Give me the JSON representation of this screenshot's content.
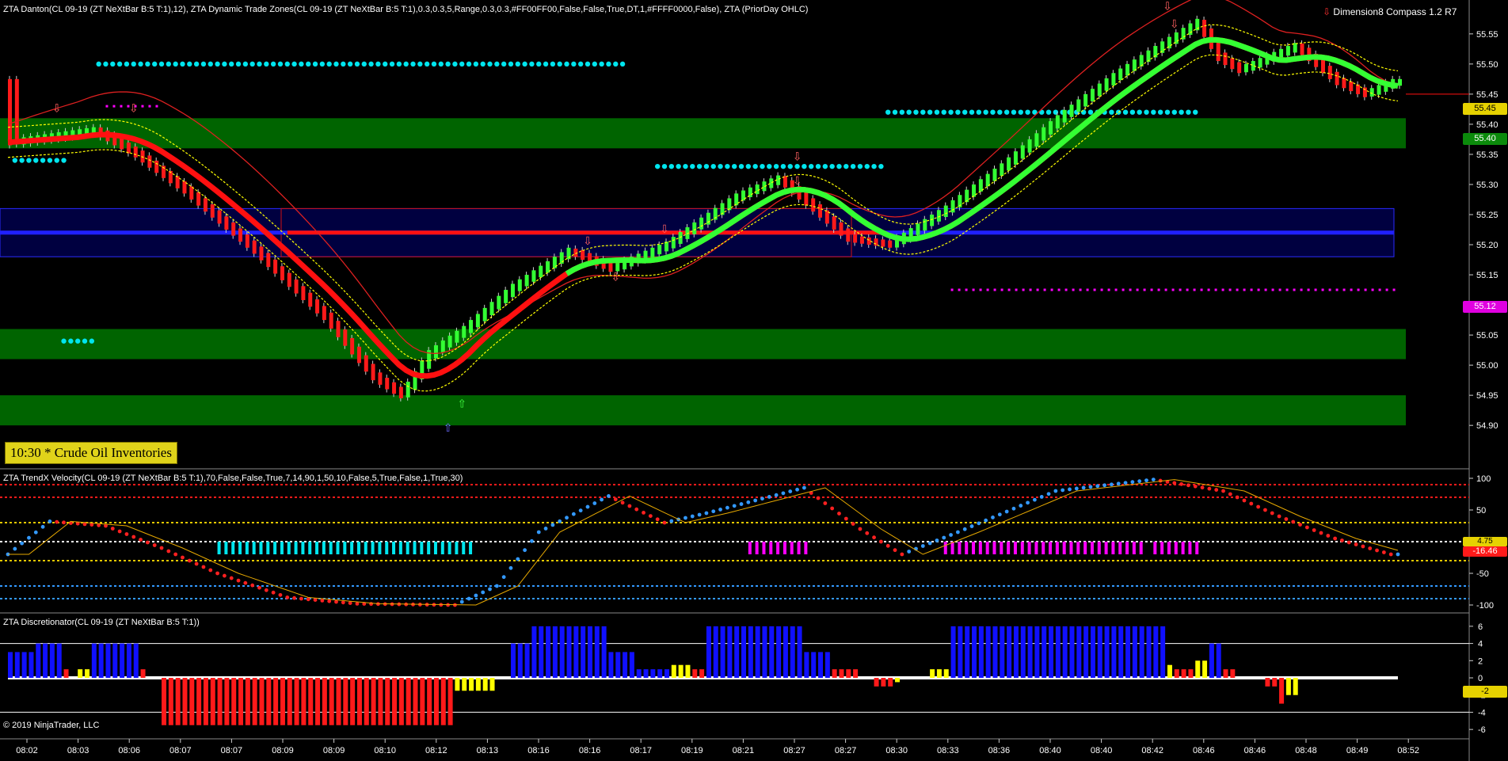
{
  "titles": {
    "price_panel": "ZTA Danton(CL 09-19 (ZT NeXtBar B:5 T:1),12), ZTA Dynamic Trade Zones(CL 09-19 (ZT NeXtBar B:5 T:1),0.3,0.3,5,Range,0.3,0.3,#FF00FF00,False,False,True,DT,1,#FFFF0000,False), ZTA (PriorDay OHLC)",
    "velocity_panel": "ZTA TrendX Velocity(CL 09-19 (ZT NeXtBar B:5 T:1),70,False,False,True,7,14,90,1,50,10,False,5,True,False,1,True,30)",
    "disc_panel": "ZTA Discretionator(CL 09-19 (ZT NeXtBar B:5 T:1))",
    "compass": "Dimension8 Compass 1.2 R7",
    "news": "10:30 * Crude Oil Inventories",
    "copyright": "© 2019 NinjaTrader, LLC"
  },
  "badges": {
    "last": "55.45",
    "zone": "55.40",
    "magenta": "55.12",
    "vel_a": "4.75",
    "vel_b": "-16.46",
    "disc": "-2"
  },
  "colors": {
    "bull": "#33ff33",
    "bear": "#ff1a1a",
    "zone": "#006400",
    "cyan": "#00e5ee",
    "magenta": "#ff00ff",
    "blue": "#1010ff",
    "yellow": "#ffff00"
  },
  "chart_data": [
    {
      "type": "bar",
      "name": "price",
      "x_ticks": [
        "08:02",
        "08:03",
        "08:06",
        "08:07",
        "08:07",
        "08:09",
        "08:09",
        "08:10",
        "08:12",
        "08:13",
        "08:16",
        "08:16",
        "08:17",
        "08:19",
        "08:21",
        "08:27",
        "08:27",
        "08:30",
        "08:33",
        "08:36",
        "08:40",
        "08:40",
        "08:42",
        "08:46",
        "08:46",
        "08:48",
        "08:49",
        "08:52"
      ],
      "y_ticks": [
        54.9,
        54.95,
        55.0,
        55.05,
        55.1,
        55.15,
        55.2,
        55.25,
        55.3,
        55.35,
        55.4,
        55.45,
        55.5,
        55.55
      ],
      "ylim": [
        54.87,
        55.58
      ],
      "anchors": [
        [
          0,
          55.37
        ],
        [
          12,
          55.39
        ],
        [
          18,
          55.35
        ],
        [
          25,
          55.29
        ],
        [
          35,
          55.19
        ],
        [
          45,
          55.08
        ],
        [
          52,
          54.98
        ],
        [
          56,
          54.95
        ],
        [
          60,
          55.02
        ],
        [
          65,
          55.06
        ],
        [
          72,
          55.13
        ],
        [
          80,
          55.19
        ],
        [
          86,
          55.16
        ],
        [
          94,
          55.2
        ],
        [
          104,
          55.28
        ],
        [
          110,
          55.31
        ],
        [
          116,
          55.25
        ],
        [
          120,
          55.21
        ],
        [
          126,
          55.2
        ],
        [
          134,
          55.26
        ],
        [
          142,
          55.33
        ],
        [
          150,
          55.41
        ],
        [
          158,
          55.48
        ],
        [
          166,
          55.54
        ],
        [
          170,
          55.57
        ],
        [
          173,
          55.51
        ],
        [
          176,
          55.49
        ],
        [
          184,
          55.53
        ],
        [
          190,
          55.47
        ],
        [
          194,
          55.45
        ],
        [
          198,
          55.47
        ]
      ],
      "bar_count": 200,
      "supply_zones": [
        [
          55.36,
          55.41
        ],
        [
          55.01,
          55.06
        ],
        [
          54.9,
          54.95
        ]
      ],
      "prior_day_box": [
        55.18,
        55.26
      ],
      "blue_line": 55.22,
      "red_level": 55.22,
      "magenta_level": 55.12,
      "cyan_levels": [
        [
          13,
          88,
          55.5
        ],
        [
          1,
          8,
          55.34
        ],
        [
          93,
          125,
          55.33
        ],
        [
          126,
          170,
          55.42
        ],
        [
          8,
          12,
          55.04
        ]
      ],
      "magenta_short": [
        [
          14,
          22,
          55.43
        ]
      ]
    },
    {
      "type": "line",
      "name": "velocity",
      "y_ticks": [
        100,
        50,
        0,
        -50,
        -100
      ],
      "ylim": [
        -105,
        105
      ],
      "levels": [
        {
          "v": 90,
          "c": "#ff1a1a"
        },
        {
          "v": 70,
          "c": "#ff1a1a"
        },
        {
          "v": 30,
          "c": "#e6c800"
        },
        {
          "v": 0,
          "c": "#ffffff"
        },
        {
          "v": -30,
          "c": "#e6c800"
        },
        {
          "v": -70,
          "c": "#3399ff"
        },
        {
          "v": -90,
          "c": "#3399ff"
        }
      ],
      "anchors": [
        [
          0,
          -20
        ],
        [
          6,
          32
        ],
        [
          14,
          25
        ],
        [
          22,
          -10
        ],
        [
          30,
          -50
        ],
        [
          40,
          -88
        ],
        [
          50,
          -98
        ],
        [
          64,
          -100
        ],
        [
          70,
          -70
        ],
        [
          76,
          15
        ],
        [
          86,
          72
        ],
        [
          94,
          30
        ],
        [
          100,
          45
        ],
        [
          114,
          85
        ],
        [
          122,
          20
        ],
        [
          128,
          -20
        ],
        [
          136,
          15
        ],
        [
          150,
          80
        ],
        [
          164,
          98
        ],
        [
          174,
          80
        ],
        [
          182,
          40
        ],
        [
          190,
          5
        ],
        [
          198,
          -20
        ]
      ],
      "cyan_band": [
        30,
        66
      ],
      "magenta_bands": [
        [
          106,
          114
        ],
        [
          134,
          162
        ],
        [
          164,
          170
        ]
      ]
    },
    {
      "type": "bar",
      "name": "discretionator",
      "y_ticks": [
        6,
        4,
        2,
        0,
        -2,
        -4,
        -6
      ],
      "ylim": [
        -7,
        7
      ],
      "segments": [
        [
          0,
          4,
          3,
          "blue"
        ],
        [
          4,
          8,
          4,
          "blue"
        ],
        [
          8,
          9,
          1,
          "red"
        ],
        [
          10,
          12,
          1,
          "yellow"
        ],
        [
          12,
          19,
          4,
          "blue"
        ],
        [
          19,
          20,
          1,
          "red"
        ],
        [
          22,
          64,
          -5.5,
          "red"
        ],
        [
          64,
          70,
          -1.5,
          "yellow"
        ],
        [
          72,
          75,
          4,
          "blue"
        ],
        [
          75,
          86,
          6,
          "blue"
        ],
        [
          86,
          90,
          3,
          "blue"
        ],
        [
          90,
          95,
          1,
          "blue"
        ],
        [
          95,
          98,
          1.5,
          "yellow"
        ],
        [
          98,
          100,
          1,
          "red"
        ],
        [
          100,
          114,
          6,
          "blue"
        ],
        [
          114,
          118,
          3,
          "blue"
        ],
        [
          118,
          122,
          1,
          "red"
        ],
        [
          124,
          127,
          -1,
          "red"
        ],
        [
          127,
          128,
          -0.5,
          "yellow"
        ],
        [
          132,
          135,
          1,
          "yellow"
        ],
        [
          135,
          166,
          6,
          "blue"
        ],
        [
          166,
          167,
          1.5,
          "yellow"
        ],
        [
          167,
          170,
          1,
          "red"
        ],
        [
          170,
          172,
          2,
          "yellow"
        ],
        [
          172,
          174,
          4,
          "blue"
        ],
        [
          174,
          176,
          1,
          "red"
        ],
        [
          180,
          182,
          -1,
          "red"
        ],
        [
          182,
          183,
          -3,
          "red"
        ],
        [
          183,
          185,
          -2,
          "yellow"
        ]
      ]
    }
  ]
}
